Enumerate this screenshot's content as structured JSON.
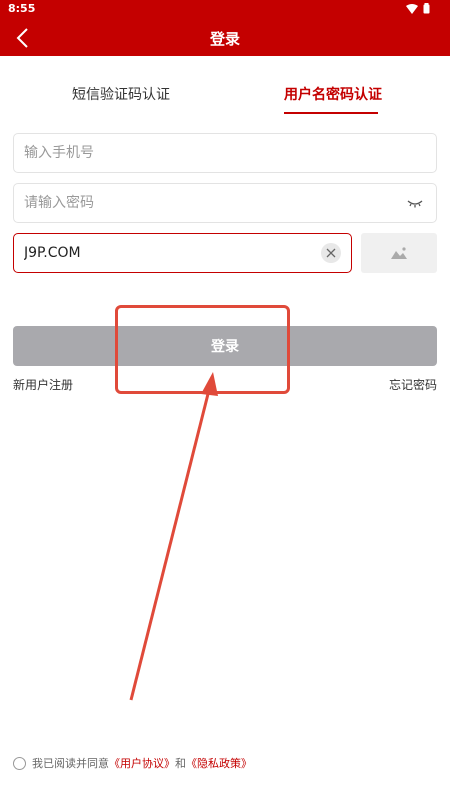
{
  "status": {
    "time": "8:55"
  },
  "header": {
    "title": "登录"
  },
  "tabs": [
    {
      "label": "短信验证码认证"
    },
    {
      "label": "用户名密码认证"
    }
  ],
  "form": {
    "phone_placeholder": "输入手机号",
    "password_placeholder": "请输入密码",
    "captcha_value": "J9P.COM"
  },
  "actions": {
    "login_label": "登录",
    "register_label": "新用户注册",
    "forgot_label": "忘记密码"
  },
  "agreement": {
    "prefix": "我已阅读并同意",
    "user_agreement": "《用户协议》",
    "and": "和",
    "privacy_policy": "《隐私政策》"
  },
  "colors": {
    "brand": "#C40000",
    "annotation": "#e04a3a",
    "button_disabled": "#a9a9ad"
  }
}
